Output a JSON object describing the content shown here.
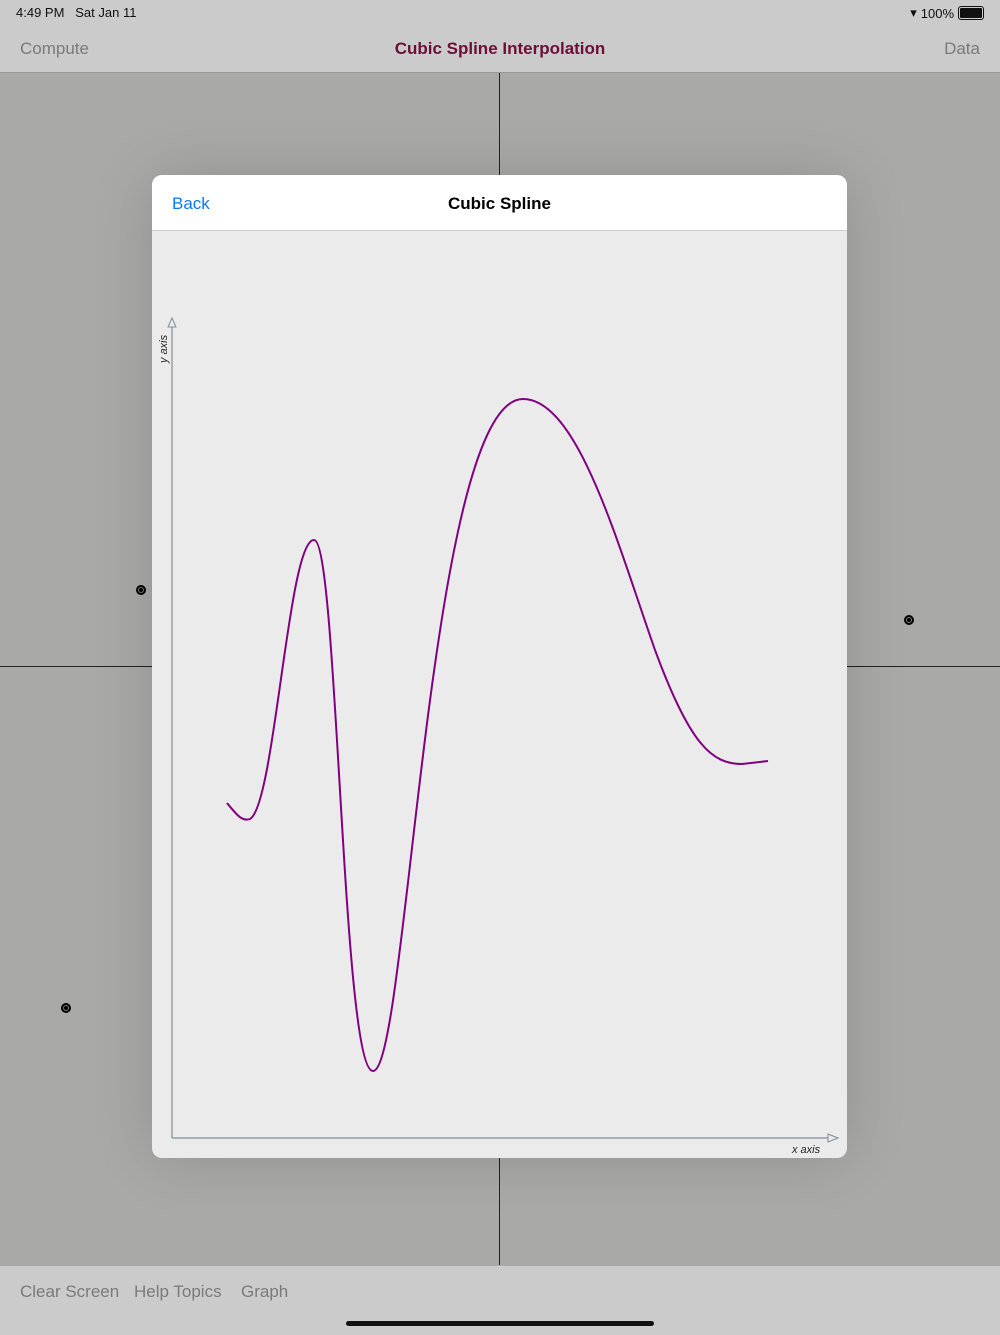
{
  "status": {
    "time": "4:49 PM",
    "date": "Sat Jan 11",
    "battery": "100%"
  },
  "nav": {
    "left": "Compute",
    "title": "Cubic Spline Interpolation",
    "right": "Data"
  },
  "toolbar": {
    "items": [
      "Clear Screen",
      "Help Topics",
      "Graph"
    ]
  },
  "modal": {
    "back": "Back",
    "title": "Cubic Spline",
    "x_label": "x axis",
    "y_label": "y axis"
  },
  "colors": {
    "curve": "#800080",
    "title": "#6b0f38",
    "link": "#0a7aff",
    "axis": "#7d8f99"
  }
}
